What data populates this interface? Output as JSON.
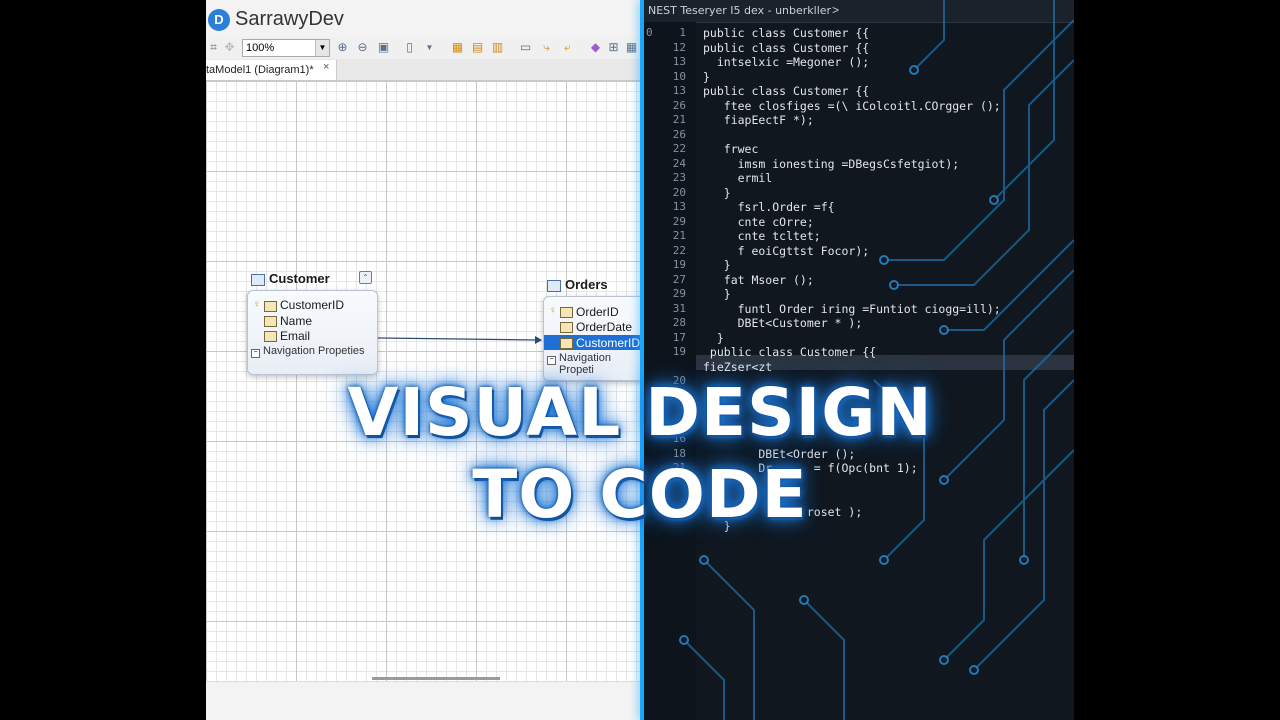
{
  "app": {
    "title": "SarrawyDev",
    "logo_glyph": "D"
  },
  "toolbar": {
    "zoom": "100%"
  },
  "document_tab": {
    "label": "taModel1 (Diagram1)*",
    "close": "×"
  },
  "entities": {
    "customer": {
      "title": "Customer",
      "fields": [
        "CustomerID",
        "Name",
        "Email"
      ],
      "navigation": "Navigation Propeties"
    },
    "orders": {
      "title": "Orders",
      "fields": [
        "OrderID",
        "OrderDate",
        "CustomerID"
      ],
      "navigation": "Navigation Propeti",
      "selected_field": "CustomerID"
    }
  },
  "editor": {
    "tab_label": "NEST Teseryer  I5 dex - unberkller",
    "tab_chevron": ">",
    "first_marker": "0",
    "lines": [
      {
        "n": "1",
        "text": "public class Customer {{"
      },
      {
        "n": "12",
        "text": "public class Customer {{"
      },
      {
        "n": "13",
        "text": "  intselxic =Megoner ();"
      },
      {
        "n": "10",
        "text": "}"
      },
      {
        "n": "13",
        "text": "public class Customer {{"
      },
      {
        "n": "26",
        "text": "   ftee closfiges =(\\ iColcoitl.COrgger ();"
      },
      {
        "n": "21",
        "text": "   fiapEectF *);"
      },
      {
        "n": "26",
        "text": ""
      },
      {
        "n": "22",
        "text": "   frwec"
      },
      {
        "n": "24",
        "text": "     imsm ionesting =DBegsCsfetgiot);"
      },
      {
        "n": "23",
        "text": "     ermil"
      },
      {
        "n": "20",
        "text": "   }"
      },
      {
        "n": "13",
        "text": "     fsrl.Order =f{"
      },
      {
        "n": "29",
        "text": "     cnte cOrre;"
      },
      {
        "n": "21",
        "text": "     cnte tcltet;"
      },
      {
        "n": "22",
        "text": "     f eoiCgttst Focor);"
      },
      {
        "n": "19",
        "text": "   }"
      },
      {
        "n": "27",
        "text": "   fat Msoer ();"
      },
      {
        "n": "29",
        "text": "   }"
      },
      {
        "n": "31",
        "text": "     funtl Order iring =Funtiot ciogg=ill);"
      },
      {
        "n": "28",
        "text": "     DBEt<Customer * );"
      },
      {
        "n": "17",
        "text": "  }"
      },
      {
        "n": "19",
        "text": " public class Customer {{"
      },
      {
        "n": "",
        "text": "fieZser<zt"
      },
      {
        "n": "20",
        "text": ""
      },
      {
        "n": "",
        "text": ""
      },
      {
        "n": "",
        "text": ""
      },
      {
        "n": "",
        "text": ""
      },
      {
        "n": "16",
        "text": ""
      },
      {
        "n": "18",
        "text": "        DBEt<Order ();"
      },
      {
        "n": "21",
        "text": "        Dr      = f(Opc(bnt 1);"
      },
      {
        "n": "",
        "text": ""
      },
      {
        "n": "",
        "text": ""
      },
      {
        "n": "",
        "text": "               roset );"
      },
      {
        "n": "",
        "text": "   }"
      }
    ]
  },
  "headline": {
    "line1": "VISUAL DESIGN",
    "line2": "TO CODE"
  },
  "colors": {
    "divider": "#1aa6ff",
    "editor_bg": "#10171f",
    "circuit": "#1e6fa8",
    "selection": "#1f6fd6"
  }
}
